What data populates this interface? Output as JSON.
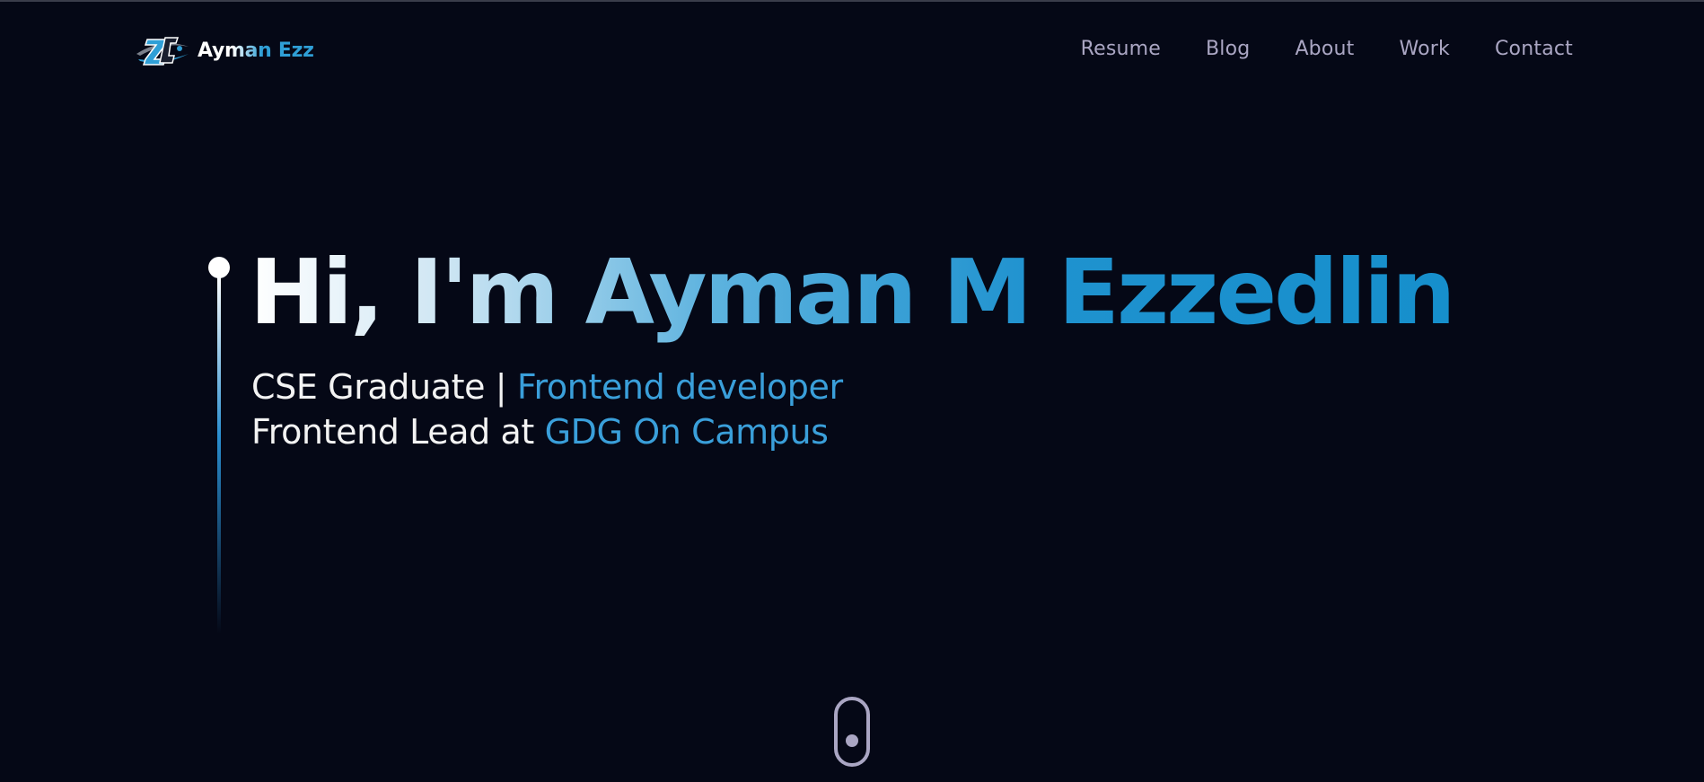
{
  "navbar": {
    "brand_name": "Ayman Ezz",
    "logo_icon": "az-logo-icon",
    "links": [
      {
        "label": "Resume"
      },
      {
        "label": "Blog"
      },
      {
        "label": "About"
      },
      {
        "label": "Work"
      },
      {
        "label": "Contact"
      }
    ]
  },
  "hero": {
    "title": "Hi, I'm Ayman M Ezzedlin",
    "line1_prefix": "CSE Graduate |",
    "line1_accent": "Frontend developer",
    "line2_prefix": "Frontend Lead at",
    "line2_accent": "GDG On Campus"
  },
  "scroll_indicator": {
    "icon": "mouse-scroll-icon"
  },
  "colors": {
    "background": "#050816",
    "accent": "#3a9fda",
    "nav_text": "#aaa6c3",
    "text": "#f3f3f3"
  }
}
